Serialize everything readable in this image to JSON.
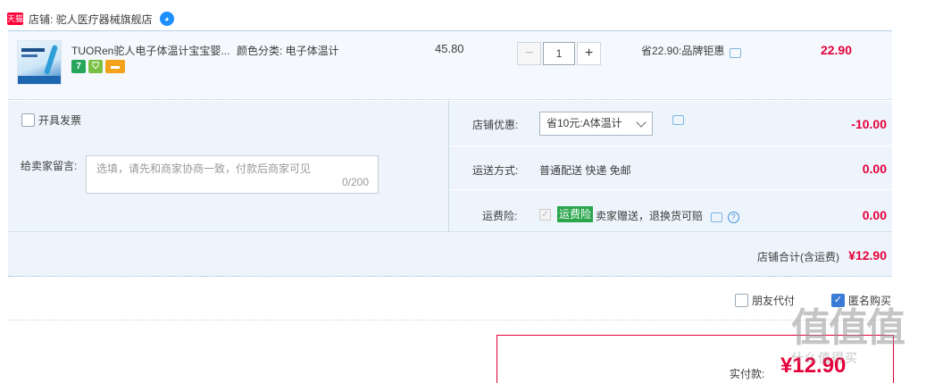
{
  "store": {
    "badge": "天猫",
    "name": "店铺: 驼人医疗器械旗舰店",
    "chat_icon": "wangwang-icon"
  },
  "item": {
    "title": "TUORen驼人电子体温计宝宝婴...",
    "sku": "颜色分类: 电子体温计",
    "unit_price": "45.80",
    "quantity": "1",
    "promo": "省22.90:品牌钜惠",
    "total": "22.90",
    "badges": [
      "7",
      "盾",
      "卡"
    ]
  },
  "options": {
    "invoice_label": "开具发票",
    "message_label": "给卖家留言:",
    "message_placeholder": "选填，请先和商家协商一致，付款后商家可见",
    "message_counter": "0/200",
    "store_discount_label": "店铺优惠:",
    "store_discount_option": "省10元:A体温计",
    "store_discount_value": "-10.00",
    "shipping_label": "运送方式:",
    "shipping_method": "普通配送 快递 免邮",
    "shipping_value": "0.00",
    "insurance_label": "运费险:",
    "insurance_tag": "运费险",
    "insurance_text": "卖家赠送，退换货可赔",
    "insurance_value": "0.00"
  },
  "store_total": {
    "label": "店铺合计(含运费)",
    "value": "¥12.90"
  },
  "bottom": {
    "friend_pay": "朋友代付",
    "anonymous": "匿名购买",
    "anonymous_checked": true
  },
  "pay": {
    "label": "实付款:",
    "value": "¥12.90"
  },
  "watermark": {
    "top": "值值值",
    "bottom": "什么值得买"
  },
  "colors": {
    "price_red": "#e4003a",
    "panel_bg": "#eef4fb",
    "insurance_green": "#2aa64c",
    "tmall_red": "#ff0036"
  }
}
